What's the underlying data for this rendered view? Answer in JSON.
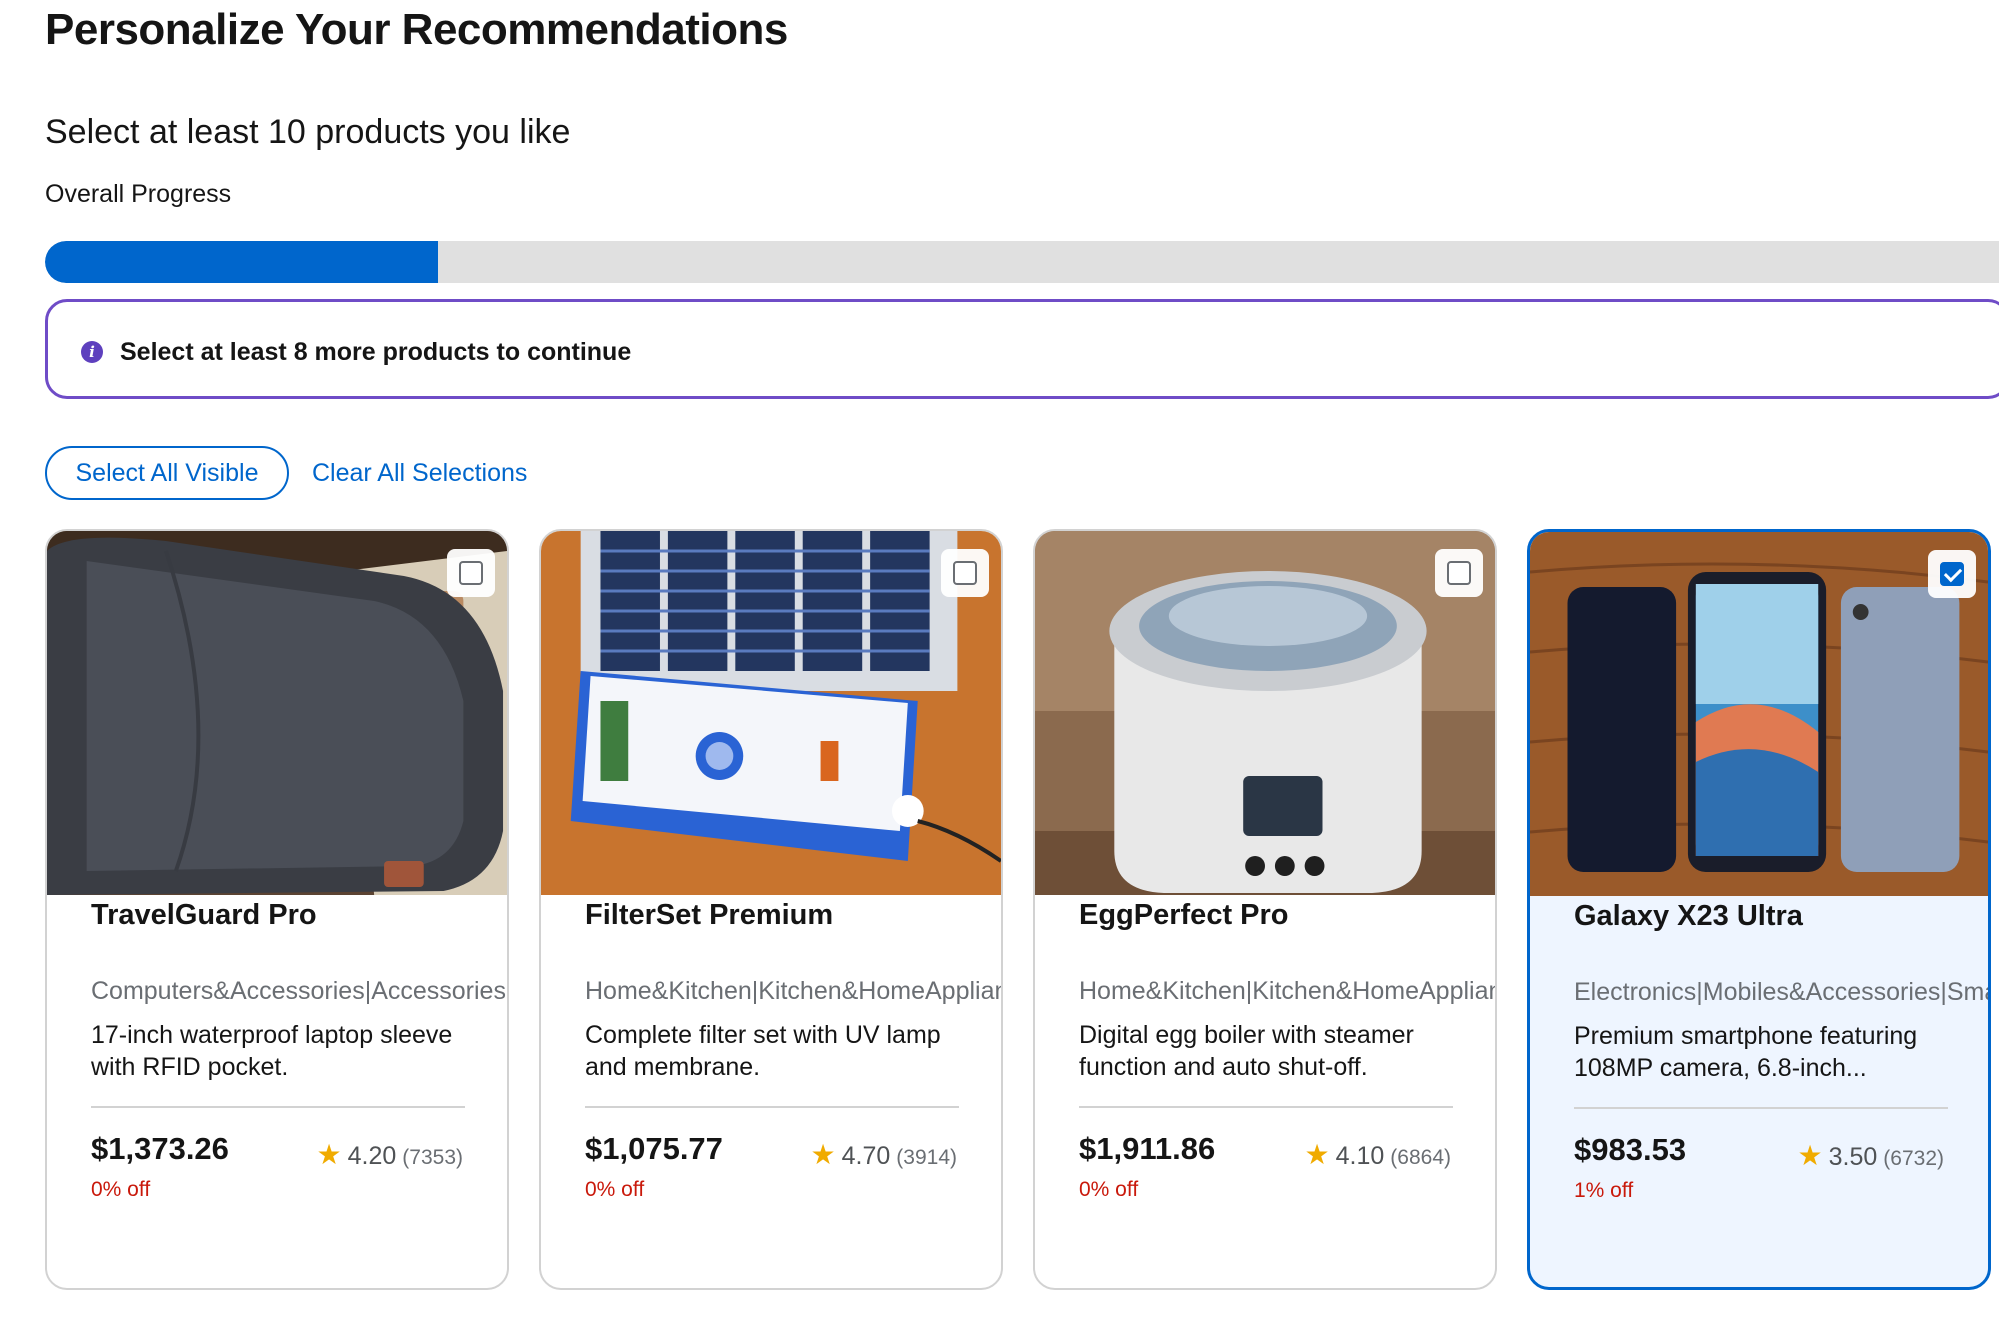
{
  "page": {
    "title": "Personalize Your Recommendations",
    "subtitle": "Select at least 10 products you like",
    "progress_label": "Overall Progress",
    "progress_fraction": 0.2,
    "alert": "Select at least 8 more products to continue"
  },
  "actions": {
    "select_all": "Select All Visible",
    "clear_all": "Clear All Selections"
  },
  "colors": {
    "accent": "#0066cc",
    "alert_border": "#6f4cc7",
    "discount": "#c9190b",
    "star": "#f0ab00"
  },
  "products": [
    {
      "name": "TravelGuard Pro",
      "category": "Computers&Accessories|Accessories",
      "description": "17-inch waterproof laptop sleeve with RFID pocket.",
      "price": "$1,373.26",
      "discount": "0% off",
      "rating": "4.20",
      "reviews": "(7353)",
      "selected": false
    },
    {
      "name": "FilterSet Premium",
      "category": "Home&Kitchen|Kitchen&HomeAppliances",
      "description": "Complete filter set with UV lamp and membrane.",
      "price": "$1,075.77",
      "discount": "0% off",
      "rating": "4.70",
      "reviews": "(3914)",
      "selected": false
    },
    {
      "name": "EggPerfect Pro",
      "category": "Home&Kitchen|Kitchen&HomeAppliances",
      "description": "Digital egg boiler with steamer function and auto shut-off.",
      "price": "$1,911.86",
      "discount": "0% off",
      "rating": "4.10",
      "reviews": "(6864)",
      "selected": false
    },
    {
      "name": "Galaxy X23 Ultra",
      "category": "Electronics|Mobiles&Accessories|Smartphones",
      "description": "Premium smartphone featuring 108MP camera, 6.8-inch...",
      "price": "$983.53",
      "discount": "1% off",
      "rating": "3.50",
      "reviews": "(6732)",
      "selected": true
    }
  ]
}
